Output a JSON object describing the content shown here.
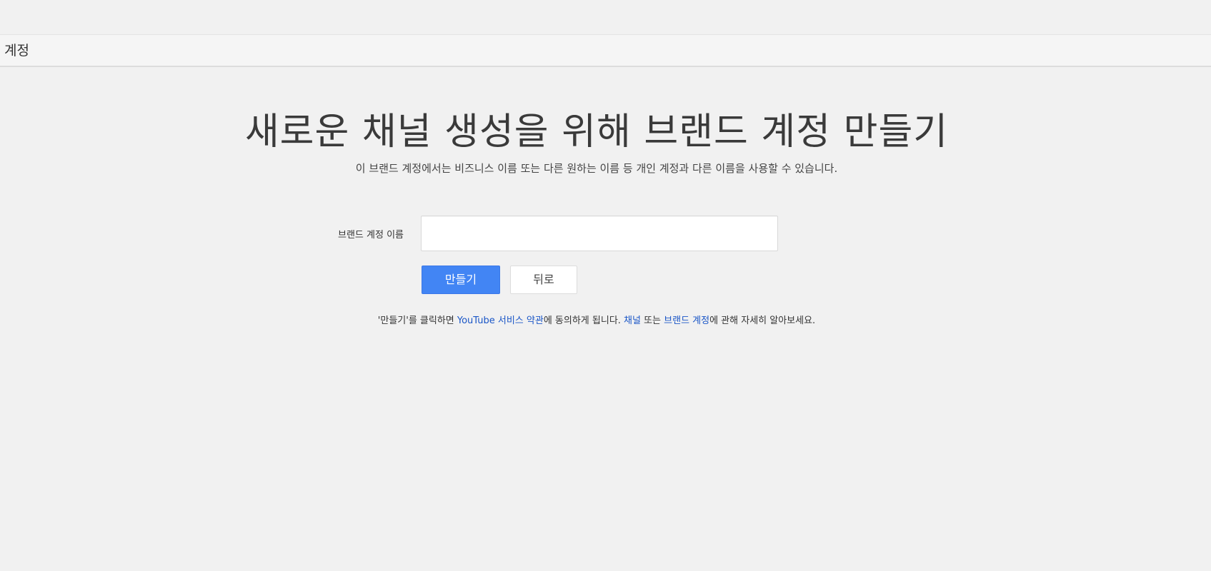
{
  "header": {
    "title": "계정"
  },
  "main": {
    "title": "새로운 채널 생성을 위해 브랜드 계정 만들기",
    "subtitle": "이 브랜드 계정에서는 비즈니스 이름 또는 다른 원하는 이름 등 개인 계정과 다른 이름을 사용할 수 있습니다.",
    "form": {
      "name_label": "브랜드 계정 이름",
      "name_value": "",
      "create_label": "만들기",
      "back_label": "뒤로"
    },
    "terms": {
      "prefix": "'만들기'를 클릭하면 ",
      "tos_link": "YouTube 서비스 약관",
      "middle": "에 동의하게 됩니다. ",
      "channel_link": "채널",
      "or_text": " 또는 ",
      "brand_link": "브랜드 계정",
      "suffix": "에 관해 자세히 알아보세요."
    }
  },
  "colors": {
    "primary_button": "#4285f4",
    "link": "#1a56c7",
    "background": "#f1f1f1"
  }
}
